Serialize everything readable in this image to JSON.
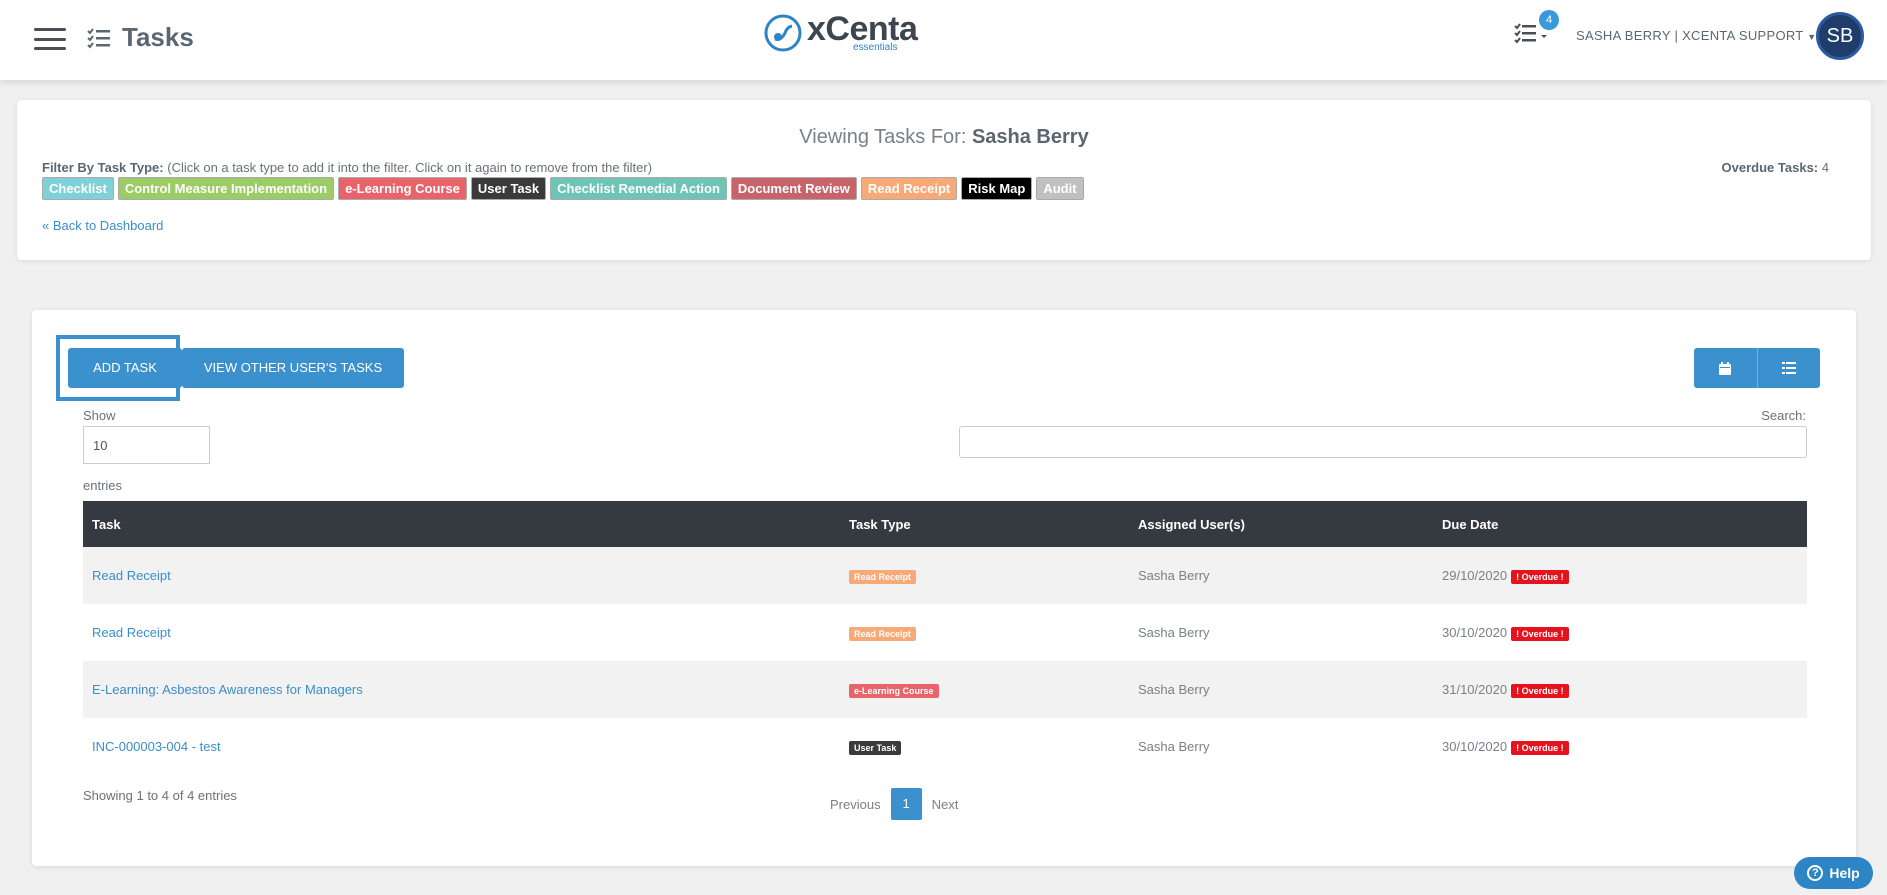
{
  "header": {
    "title": "Tasks",
    "logo_main": "xCenta",
    "logo_sub": "essentials",
    "notification_count": "4",
    "user_label": "SASHA BERRY | XCENTA SUPPORT",
    "avatar_initials": "SB"
  },
  "filter": {
    "viewing_prefix": "Viewing Tasks For:",
    "viewing_user": "Sasha Berry",
    "label_bold": "Filter By Task Type:",
    "label_hint": "(Click on a task type to add it into the filter. Click on it again to remove from the filter)",
    "overdue_label": "Overdue Tasks:",
    "overdue_value": "4",
    "chips": [
      {
        "label": "Checklist",
        "color": "#7fd1d8"
      },
      {
        "label": "Control Measure Implementation",
        "color": "#9ccc65"
      },
      {
        "label": "e-Learning Course",
        "color": "#e8646a"
      },
      {
        "label": "User Task",
        "color": "#3a3a3a"
      },
      {
        "label": "Checklist Remedial Action",
        "color": "#6ec5b6"
      },
      {
        "label": "Document Review",
        "color": "#c86469"
      },
      {
        "label": "Read Receipt",
        "color": "#f7a978"
      },
      {
        "label": "Risk Map",
        "color": "#000000"
      },
      {
        "label": "Audit",
        "color": "#c0c0c0"
      }
    ],
    "back_link": "« Back to Dashboard"
  },
  "tasks": {
    "add_task_label": "ADD TASK",
    "view_other_label": "VIEW OTHER USER'S TASKS",
    "show_label": "Show",
    "show_value": "10",
    "entries_label": "entries",
    "search_label": "Search:",
    "columns": [
      "Task",
      "Task Type",
      "Assigned User(s)",
      "Due Date"
    ],
    "rows": [
      {
        "task": "Read Receipt",
        "type": "Read Receipt",
        "type_color": "#f7a978",
        "user": "Sasha Berry",
        "due": "29/10/2020",
        "status": "! Overdue !"
      },
      {
        "task": "Read Receipt",
        "type": "Read Receipt",
        "type_color": "#f7a978",
        "user": "Sasha Berry",
        "due": "30/10/2020",
        "status": "! Overdue !"
      },
      {
        "task": "E-Learning: Asbestos Awareness for Managers",
        "type": "e-Learning Course",
        "type_color": "#e8646a",
        "user": "Sasha Berry",
        "due": "31/10/2020",
        "status": "! Overdue !"
      },
      {
        "task": "INC-000003-004 - test",
        "type": "User Task",
        "type_color": "#3a3a3a",
        "user": "Sasha Berry",
        "due": "30/10/2020",
        "status": "! Overdue !"
      }
    ],
    "showing_text": "Showing 1 to 4 of 4 entries",
    "pager_prev": "Previous",
    "pager_current": "1",
    "pager_next": "Next"
  },
  "help_label": "Help"
}
